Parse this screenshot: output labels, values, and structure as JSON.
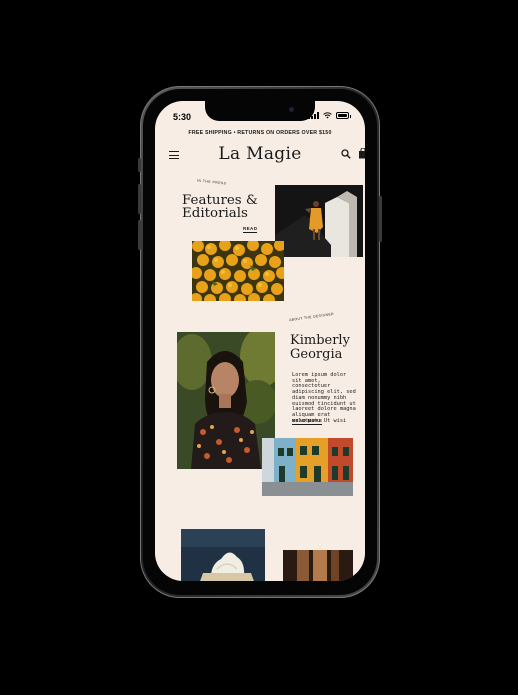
{
  "status_bar": {
    "time": "5:30"
  },
  "promo_banner": "FREE SHIPPING • RETURNS ON ORDERS OVER $150",
  "header": {
    "brand": "La Magie"
  },
  "press_section": {
    "arc_label": "IN THE PRESS",
    "title": "Features & Editorials",
    "read_label": "READ"
  },
  "designer_section": {
    "arc_label": "ABOUT THE DESIGNER",
    "title": "Kimberly Georgia",
    "body": "Lorem ipsum dolor sit amet, consectetuer adipiscing elit, sed diam nonummy nibh euismod tincidunt ut laoreet dolore magna aliquam erat volutpat. Ut wisi",
    "read_more_label": "READ MORE"
  },
  "colors": {
    "screen_bg": "#f8ede4",
    "text": "#1a1a1a"
  }
}
